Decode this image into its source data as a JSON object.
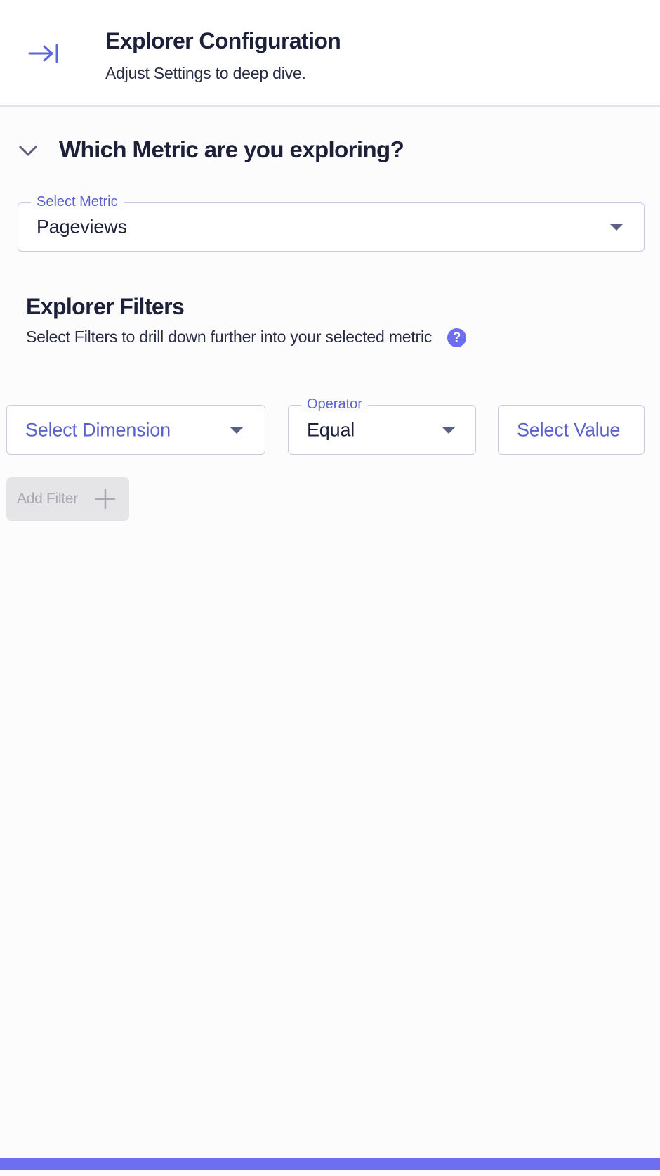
{
  "header": {
    "title": "Explorer Configuration",
    "subtitle": "Adjust Settings to deep dive."
  },
  "metric_section": {
    "title": "Which Metric are you exploring?",
    "select_metric": {
      "label": "Select Metric",
      "value": "Pageviews"
    }
  },
  "filters": {
    "title": "Explorer Filters",
    "description": "Select Filters to drill down further into your selected metric",
    "help_glyph": "?",
    "dimension": {
      "placeholder": "Select Dimension"
    },
    "operator": {
      "label": "Operator",
      "value": "Equal"
    },
    "value_field": {
      "placeholder": "Select Value"
    },
    "add_filter_label": "Add Filter"
  },
  "colors": {
    "accent": "#6c6ef0",
    "label_purple": "#5a62c9",
    "text_dark": "#1c2039",
    "disabled_bg": "#e5e5e8",
    "disabled_text": "#a9a9b1"
  },
  "icons": {
    "collapse": "arrow-right-to-bar-icon",
    "toggle": "chevron-down-icon",
    "help": "question-circle-icon",
    "add": "plus-icon"
  }
}
